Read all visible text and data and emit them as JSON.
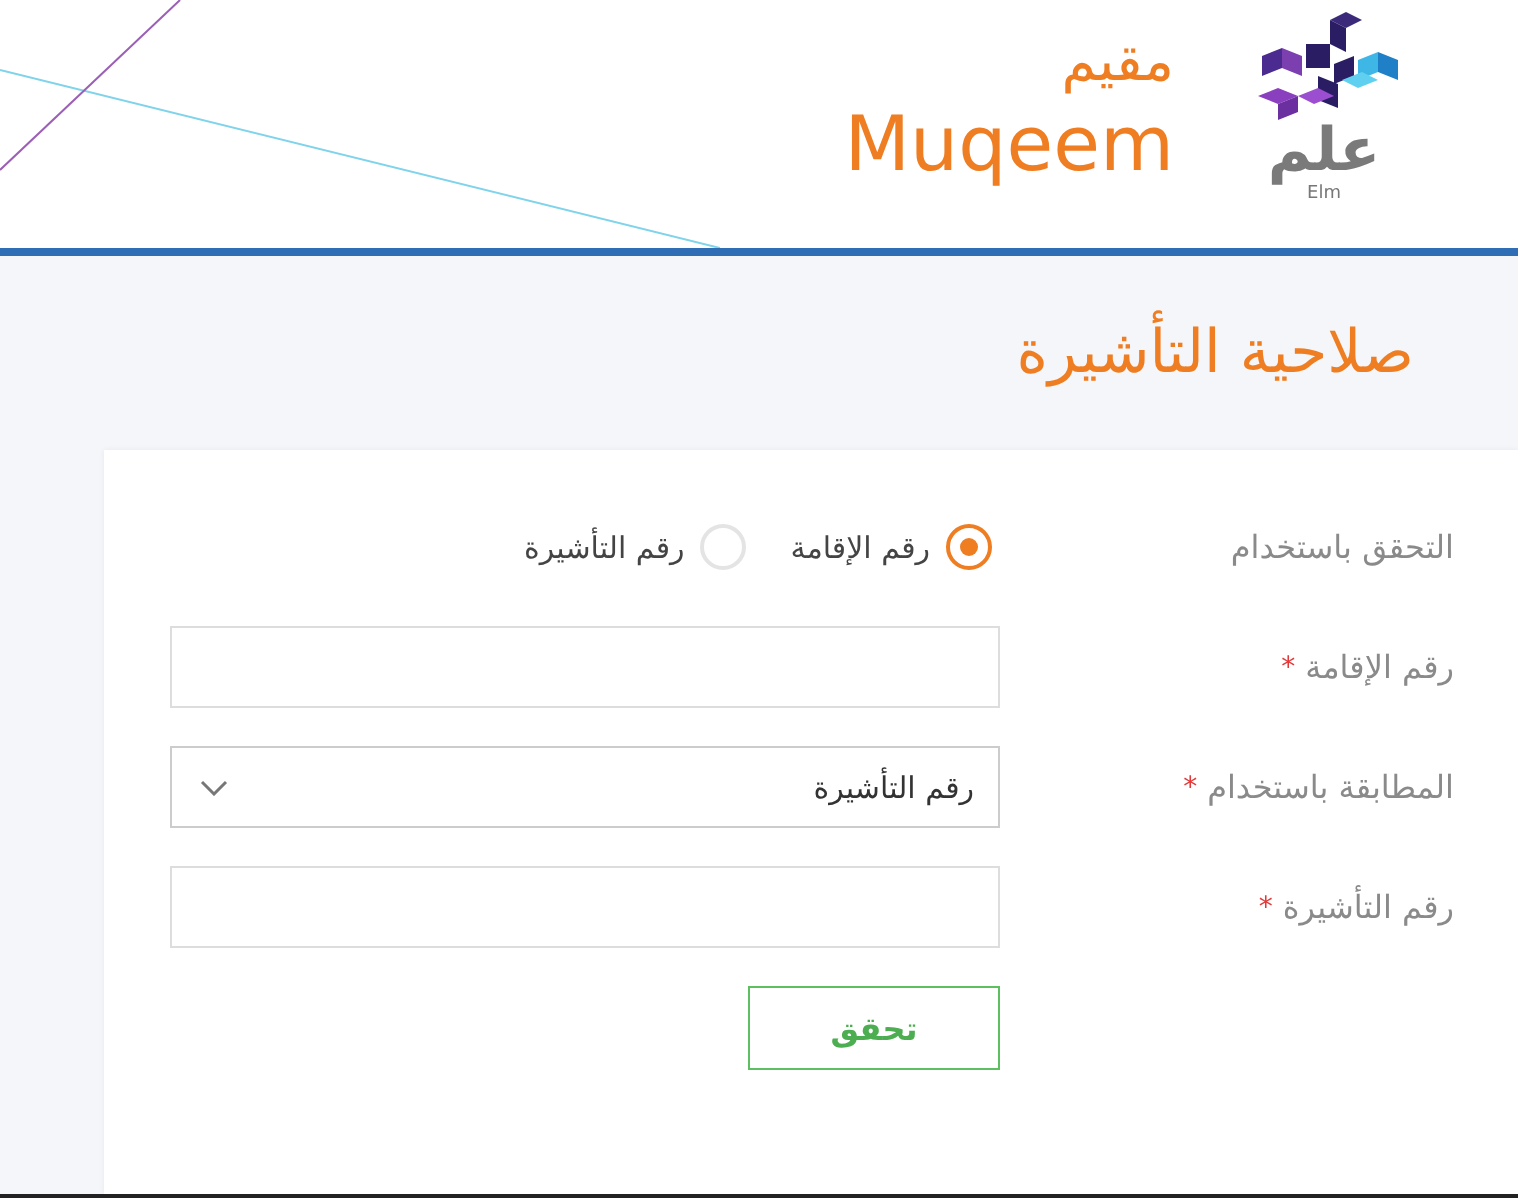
{
  "header": {
    "elm_logo": {
      "arabic": "علم",
      "latin": "Elm"
    },
    "muqeem_logo": {
      "arabic": "مقيم",
      "latin": "Muqeem"
    }
  },
  "page_title": "صلاحية التأشيرة",
  "form": {
    "rows": [
      {
        "kind": "radio",
        "label": "التحقق باستخدام",
        "options": [
          {
            "label": "رقم الإقامة",
            "selected": true
          },
          {
            "label": "رقم التأشيرة",
            "selected": false
          }
        ]
      },
      {
        "kind": "text",
        "label": "رقم الإقامة",
        "required_mark": "*"
      },
      {
        "kind": "select",
        "label": "المطابقة باستخدام",
        "required_mark": "*",
        "value": "رقم التأشيرة"
      },
      {
        "kind": "text",
        "label": "رقم التأشيرة",
        "required_mark": "*"
      }
    ],
    "submit": "تحقق"
  }
}
